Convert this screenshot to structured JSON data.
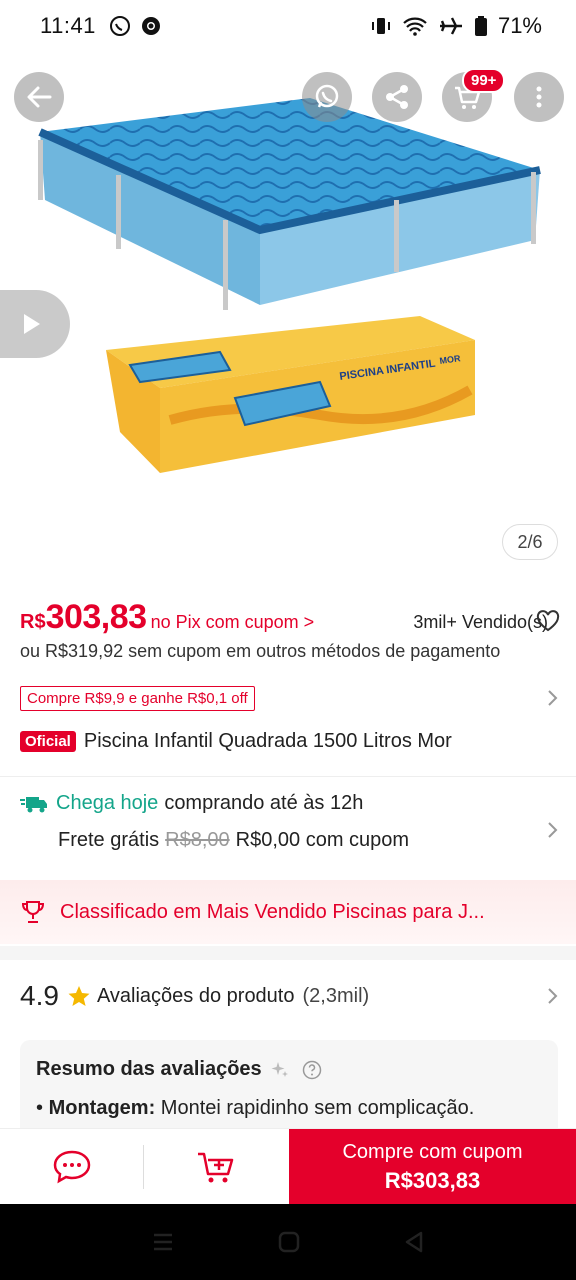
{
  "status_bar": {
    "time": "11:41",
    "battery": "71%",
    "icons": [
      "whatsapp-icon",
      "chrome-icon",
      "vibrate-icon",
      "wifi-icon",
      "airplane-icon",
      "battery-icon"
    ]
  },
  "hero": {
    "page_counter": "2/6",
    "cart_badge": "99+",
    "box_brand": "MOR",
    "box_title": "PISCINA INFANTIL"
  },
  "price": {
    "currency": "R$",
    "value": "303,83",
    "pix_label": "no Pix com cupom >",
    "sold": "3mil+ Vendido(s)",
    "alt_price": "ou R$319,92 sem cupom em outros métodos de pagamento"
  },
  "coupon": {
    "label": "Compre R$9,9 e ganhe R$0,1 off"
  },
  "product": {
    "badge": "Oficial",
    "title": "Piscina Infantil Quadrada 1500 Litros Mor"
  },
  "delivery": {
    "highlight": "Chega hoje",
    "condition": "comprando até às 12h",
    "shipping_label": "Frete grátis",
    "old_price": "R$8,00",
    "new_price": "R$0,00 com cupom"
  },
  "ranking": {
    "text": "Classificado em Mais Vendido Piscinas para J..."
  },
  "reviews": {
    "rating": "4.9",
    "label": "Avaliações do produto",
    "count": "(2,3mil)",
    "summary_title": "Resumo das avaliações",
    "bullet_key": "Montagem:",
    "bullet_text": "Montei rapidinho sem complicação."
  },
  "actions": {
    "buy_label": "Compre com cupom",
    "buy_price": "R$303,83"
  },
  "colors": {
    "accent": "#e4002b",
    "delivery_green": "#14a58a"
  }
}
